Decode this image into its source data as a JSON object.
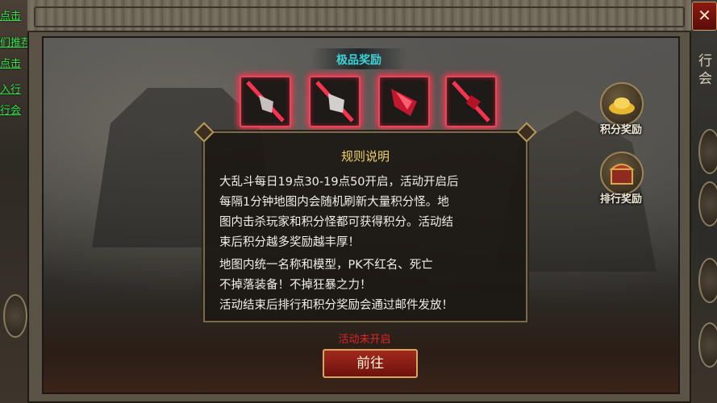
{
  "left_sidebar": {
    "links": [
      "点击",
      "们推荐",
      "点击",
      "入行",
      "行会"
    ]
  },
  "right_sidebar": {
    "text": [
      "行",
      "会"
    ]
  },
  "dialog": {
    "close_label": "✕",
    "reward_title": "极品奖励",
    "reward_items": [
      {
        "name": "reward-1",
        "icon": "gauntlet-icon"
      },
      {
        "name": "reward-2",
        "icon": "gauntlet-icon"
      },
      {
        "name": "reward-3",
        "icon": "gem-icon"
      },
      {
        "name": "reward-4",
        "icon": "crystal-icon"
      }
    ],
    "rules_title": "规则说明",
    "rules_lines": [
      "大乱斗每日19点30-19点50开启，活动开启后",
      "每隔1分钟地图内会随机刷新大量积分怪。地",
      "图内击杀玩家和积分怪都可获得积分。活动结",
      "束后积分越多奖励越丰厚！",
      "地图内统一名称和模型，PK不红名、死亡",
      "不掉落装备！不掉狂暴之力！",
      "活动结束后排行和积分奖励会通过邮件发放！"
    ],
    "status_text": "活动未开启",
    "go_button": "前往",
    "side_buttons": [
      {
        "label": "积分奖励",
        "icon": "gold-ingot-icon"
      },
      {
        "label": "排行奖励",
        "icon": "treasure-chest-icon"
      }
    ]
  },
  "colors": {
    "accent_red": "#e04a5a",
    "title_gold": "#f0d36b",
    "reward_title": "#3fd2d6",
    "status_red": "#e32424",
    "link_green": "#34e34a"
  }
}
